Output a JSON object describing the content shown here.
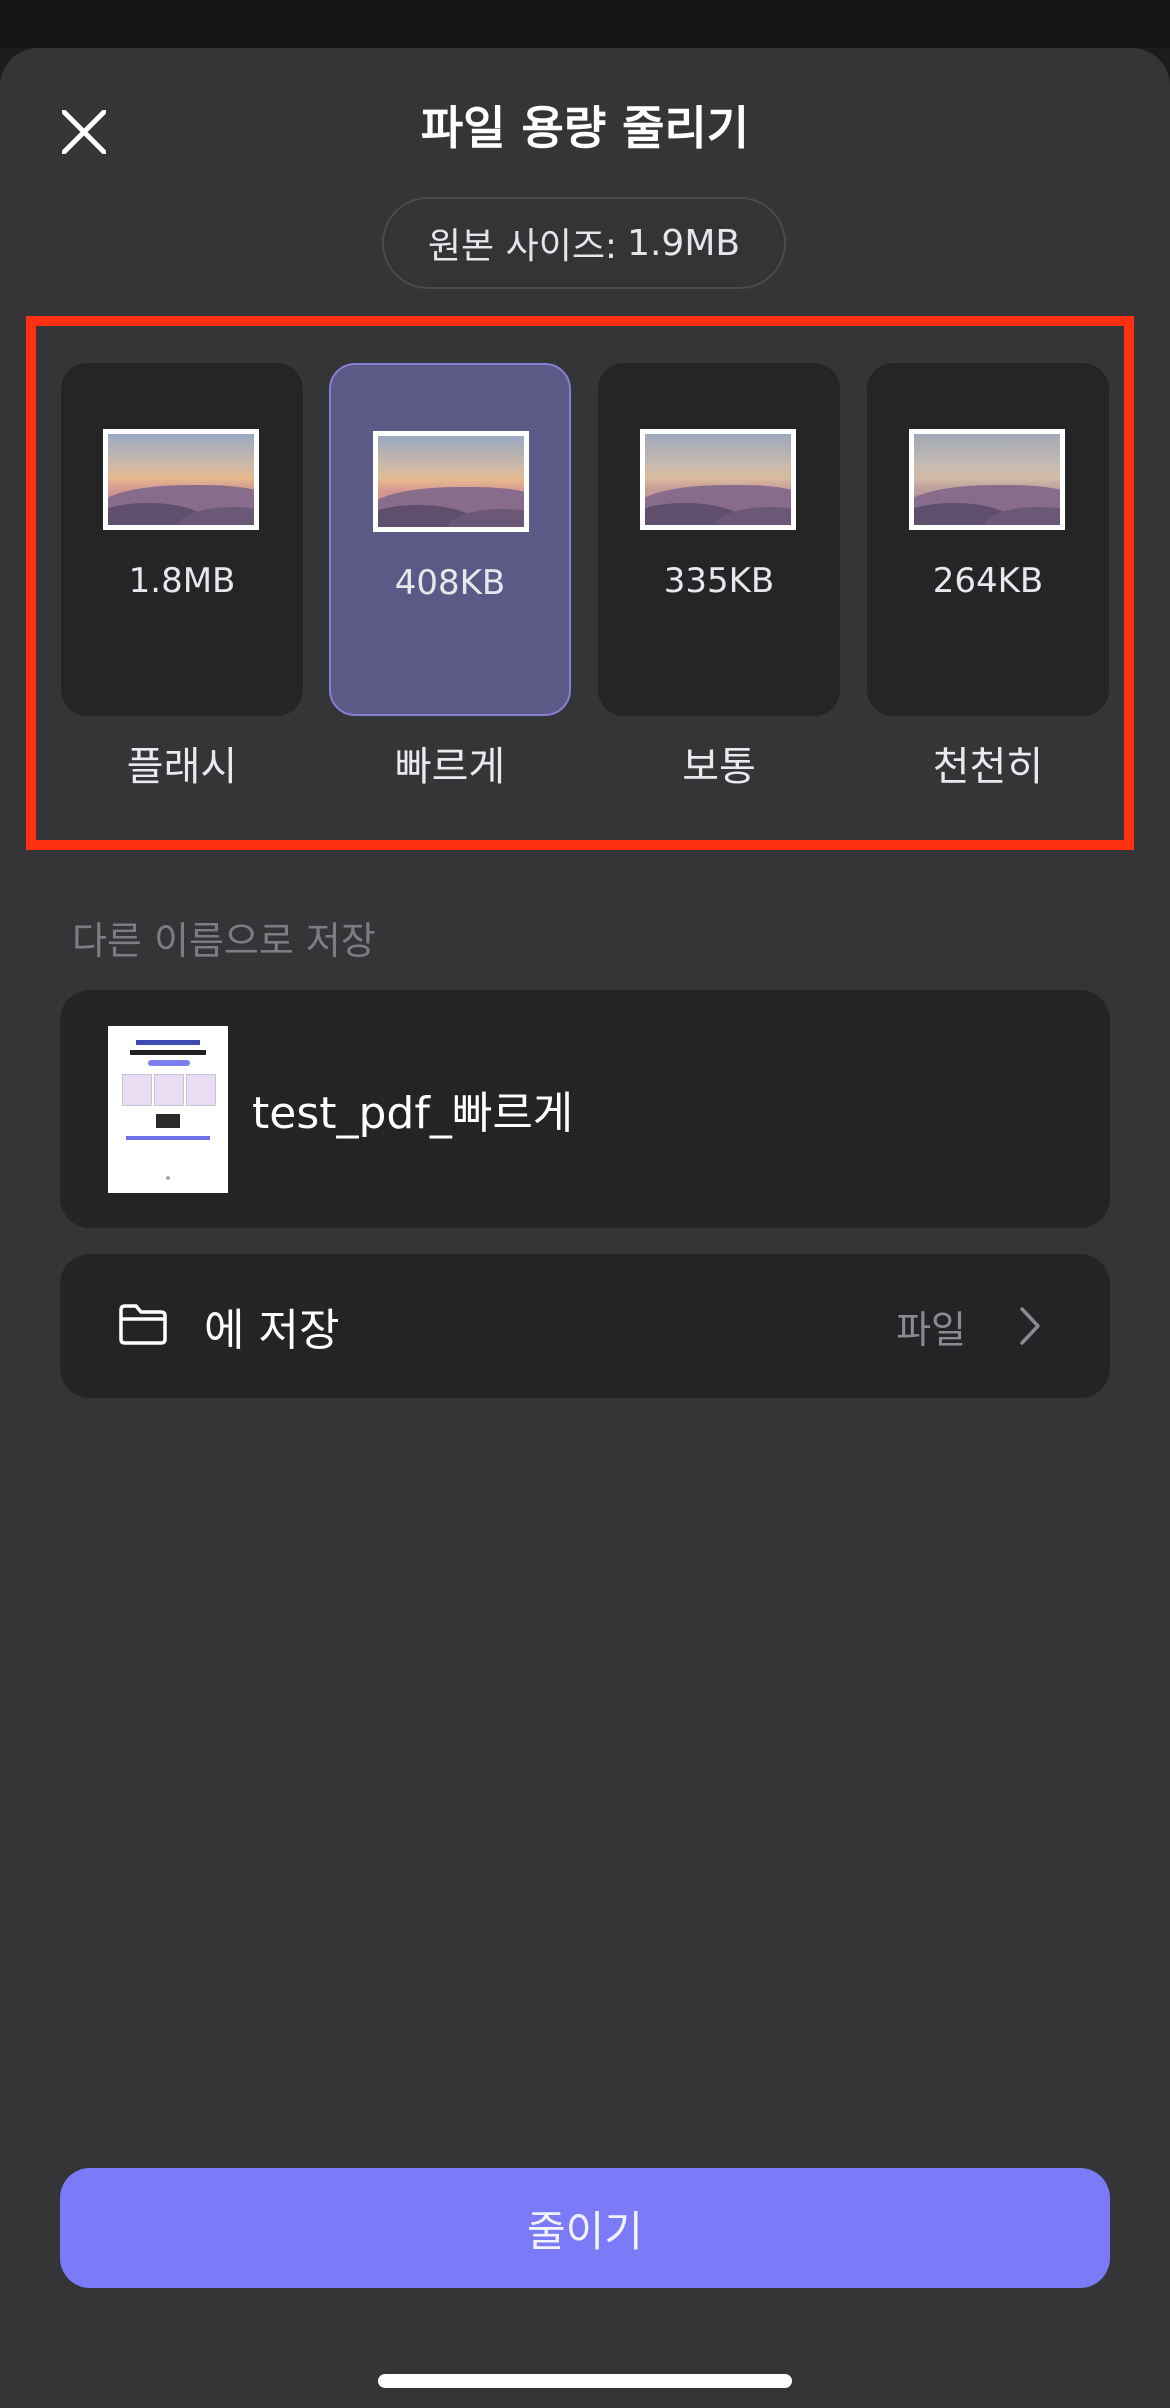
{
  "header": {
    "title": "파일 용량 줄리기",
    "original_size_label": "원본 사이즈:",
    "original_size_value": "1.9MB"
  },
  "options": [
    {
      "label": "플래시",
      "size": "1.8MB",
      "selected": false
    },
    {
      "label": "빠르게",
      "size": "408KB",
      "selected": true
    },
    {
      "label": "보통",
      "size": "335KB",
      "selected": false
    },
    {
      "label": "천천히",
      "size": "264KB",
      "selected": false
    }
  ],
  "save_as": {
    "section_label": "다른 이름으로 저장",
    "file_name": "test_pdf_빠르게"
  },
  "save_location": {
    "label": "에 저장",
    "destination": "파일"
  },
  "actions": {
    "reduce_label": "줄이기"
  },
  "colors": {
    "sheet_background": "#353538",
    "card_background": "#252527",
    "selected_card": "#5b5a86",
    "primary_button": "#7c7bf7",
    "highlight_border": "#ff2f12"
  },
  "icons": {
    "close": "close-icon",
    "folder": "folder-icon",
    "chevron": "chevron-right-icon"
  }
}
